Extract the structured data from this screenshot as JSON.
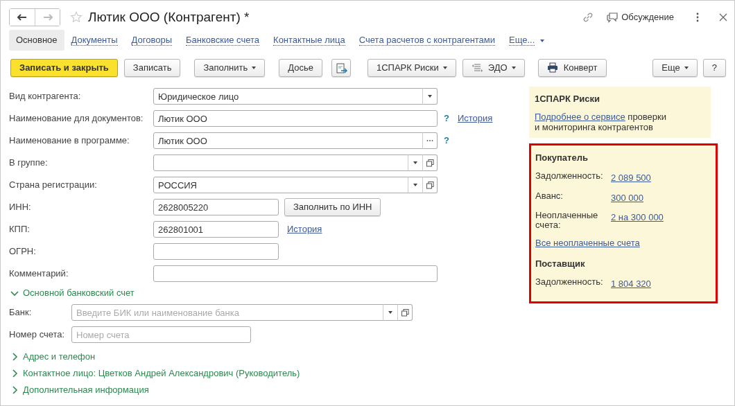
{
  "header": {
    "back_enabled": true,
    "forward_enabled": false,
    "favorite": false,
    "title": "Лютик ООО (Контрагент) *",
    "discussion": "Обсуждение"
  },
  "tabs": [
    {
      "label": "Основное",
      "selected": true
    },
    {
      "label": "Документы",
      "selected": false
    },
    {
      "label": "Договоры",
      "selected": false
    },
    {
      "label": "Банковские счета",
      "selected": false
    },
    {
      "label": "Контактные лица",
      "selected": false
    },
    {
      "label": "Счета расчетов с контрагентами",
      "selected": false
    },
    {
      "label": "Еще...",
      "selected": false,
      "kind": "menu"
    }
  ],
  "toolbar": {
    "left": [
      {
        "kind": "primary",
        "label": "Записать и закрыть"
      },
      {
        "kind": "plain",
        "label": "Записать"
      },
      {
        "kind": "menu",
        "label": "Заполнить"
      },
      {
        "kind": "plain",
        "label": "Досье"
      },
      {
        "kind": "icon"
      },
      {
        "kind": "menu",
        "label": "1СПАРК Риски"
      },
      {
        "kind": "menu",
        "label": "ЭДО",
        "icon": true
      },
      {
        "kind": "plain",
        "label": "Конверт",
        "icon": true
      }
    ],
    "right": [
      {
        "kind": "menu",
        "label": "Еще"
      },
      {
        "kind": "plain",
        "label": "?"
      }
    ]
  },
  "fields": [
    {
      "label": "Вид контрагента:",
      "value": "Юридическое лицо",
      "short": false,
      "dropdown": true
    },
    {
      "label": "Наименование для документов:",
      "value": "Лютик ООО",
      "short": false,
      "help": "?",
      "link": "История"
    },
    {
      "label": "Наименование в программе:",
      "value": "Лютик ООО",
      "short": false,
      "choice_button": true,
      "help": "?"
    },
    {
      "label": "В группе:",
      "short": false,
      "dropdown": true,
      "open_button": true
    },
    {
      "label": "Страна регистрации:",
      "value": "РОССИЯ",
      "short": false,
      "dropdown": true,
      "open_button": true
    },
    {
      "label": "ИНН:",
      "value": "2628005220",
      "short": true,
      "action": "Заполнить по ИНН"
    },
    {
      "label": "КПП:",
      "value": "262801001",
      "short": true,
      "link": "История"
    },
    {
      "label": "ОГРН:",
      "short": true
    },
    {
      "label": "Комментарий:",
      "short": false
    }
  ],
  "sections": [
    {
      "title": "Основной банковский счет",
      "expanded": true,
      "fields": [
        {
          "label": "Банк:",
          "placeholder": "Введите БИК или наименование банка",
          "short": false,
          "dropdown": true,
          "open_button": true
        },
        {
          "label": "Номер счета:",
          "placeholder": "Номер счета",
          "short": true
        }
      ]
    },
    {
      "title": "Адрес и телефон",
      "expanded": false
    },
    {
      "title": "Контактное лицо: Цветков Андрей Александрович (Руководитель)",
      "expanded": false
    },
    {
      "title": "Дополнительная информация",
      "expanded": false
    }
  ],
  "spark": {
    "title": "1СПАРК Риски",
    "link": "Подробнее о сервисе",
    "text": "проверки",
    "text_2": "и мониторинга контрагентов"
  },
  "settlements": {
    "highlighted": true,
    "groups": [
      {
        "title": "Покупатель",
        "rows": [
          {
            "label": "Задолженность:",
            "value": "2 089 500"
          },
          {
            "label": "Аванс:",
            "value": "300 000"
          },
          {
            "label": "Неоплаченные счета:",
            "value": "2 на 300 000"
          }
        ],
        "link": "Все неоплаченные счета"
      },
      {
        "title": "Поставщик",
        "rows": [
          {
            "label": "Задолженность:",
            "value": "1 804 320"
          }
        ]
      }
    ]
  }
}
